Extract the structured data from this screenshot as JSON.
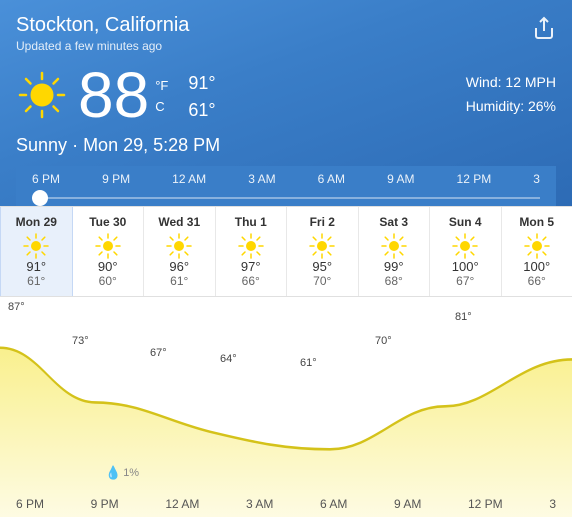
{
  "header": {
    "city": "Stockton, California",
    "updated": "Updated a few minutes ago",
    "share_label": "share"
  },
  "current": {
    "temp": "88",
    "unit_f": "°F",
    "unit_c": "C",
    "temp_high": "91°",
    "temp_low": "61°",
    "wind": "Wind: 12 MPH",
    "humidity": "Humidity: 26%",
    "condition": "Sunny",
    "datetime": "Mon 29, 5:28 PM"
  },
  "timeline": {
    "labels": [
      "6 PM",
      "9 PM",
      "12 AM",
      "3 AM",
      "6 AM",
      "9 AM",
      "12 PM",
      "3"
    ]
  },
  "days": [
    {
      "label": "Mon 29",
      "high": "91°",
      "low": "61°",
      "active": true
    },
    {
      "label": "Tue 30",
      "high": "90°",
      "low": "60°",
      "active": false
    },
    {
      "label": "Wed 31",
      "high": "96°",
      "low": "61°",
      "active": false
    },
    {
      "label": "Thu 1",
      "high": "97°",
      "low": "66°",
      "active": false
    },
    {
      "label": "Fri 2",
      "high": "95°",
      "low": "70°",
      "active": false
    },
    {
      "label": "Sat 3",
      "high": "99°",
      "low": "68°",
      "active": false
    },
    {
      "label": "Sun 4",
      "high": "100°",
      "low": "67°",
      "active": false
    },
    {
      "label": "Mon 5",
      "high": "100°",
      "low": "66°",
      "active": false
    }
  ],
  "chart": {
    "temps": [
      "87°",
      "73°",
      "67°",
      "64°",
      "61°",
      "70°",
      "81°"
    ],
    "bottom_labels": [
      "6 PM",
      "9 PM",
      "12 AM",
      "3 AM",
      "6 AM",
      "9 AM",
      "12 PM",
      "3"
    ],
    "precip": "1%"
  },
  "icons": {
    "sun": "sun",
    "share": "share"
  }
}
